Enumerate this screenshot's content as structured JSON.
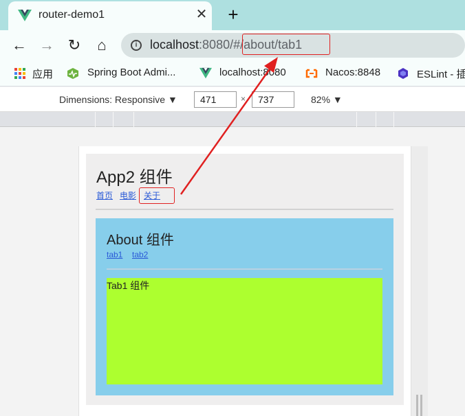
{
  "browser": {
    "tab": {
      "title": "router-demo1",
      "close_glyph": "✕",
      "logo_icon": "vue-logo-icon"
    },
    "new_tab_glyph": "+",
    "toolbar": {
      "back_glyph": "←",
      "forward_glyph": "→",
      "reload_glyph": "↻",
      "home_glyph": "⌂",
      "info_glyph": "i",
      "url_host": "localhost",
      "url_port": ":8080/",
      "url_hash": "#/about/tab1"
    },
    "bookmarks": [
      {
        "label": "应用",
        "icon": "apps-grid-icon"
      },
      {
        "label": "Spring Boot Admi...",
        "icon": "spring-boot-admin-icon"
      },
      {
        "label": "localhost:8080",
        "icon": "vue-logo-icon"
      },
      {
        "label": "Nacos:8848",
        "icon": "nacos-icon"
      },
      {
        "label": "ESLint - 插",
        "icon": "eslint-icon"
      }
    ]
  },
  "devtools": {
    "dimensions_label": "Dimensions: Responsive ▼",
    "width": "471",
    "separator": "×",
    "height": "737",
    "zoom": "82% ▼"
  },
  "app": {
    "title": "App2 组件",
    "nav": [
      "首页",
      "电影",
      "关于"
    ],
    "about": {
      "title": "About 组件",
      "tabs": [
        "tab1",
        "tab2"
      ],
      "tab1_text": "Tab1 组件"
    }
  },
  "colors": {
    "tabstrip": "#aee0e0",
    "about_bg": "#87ceeb",
    "tab1_bg": "#adff2f",
    "annotation": "#e02020",
    "link": "#2a5ad7"
  }
}
